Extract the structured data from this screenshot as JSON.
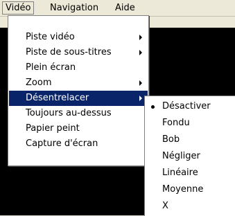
{
  "menubar": {
    "items": [
      "Vidéo",
      "Navigation",
      "Aide"
    ]
  },
  "video_menu": {
    "items": [
      {
        "label": "Piste vidéo",
        "submenu": true
      },
      {
        "label": "Piste de sous-titres",
        "submenu": true
      },
      {
        "label": "Plein écran",
        "submenu": false
      },
      {
        "label": "Zoom",
        "submenu": true
      },
      {
        "label": "Désentrelacer",
        "submenu": true,
        "selected": true
      },
      {
        "label": "Toujours au-dessus",
        "submenu": false
      },
      {
        "label": "Papier peint",
        "submenu": false
      },
      {
        "label": "Capture d'écran",
        "submenu": false
      }
    ]
  },
  "deinterlace_menu": {
    "items": [
      {
        "label": "Désactiver",
        "checked": true
      },
      {
        "label": "Fondu"
      },
      {
        "label": "Bob"
      },
      {
        "label": "Négliger"
      },
      {
        "label": "Linéaire"
      },
      {
        "label": "Moyenne"
      },
      {
        "label": "X"
      }
    ]
  },
  "colors": {
    "menu_highlight": "#0a246a",
    "menubar_bg": "#ece9d8",
    "video_bg": "#000000"
  }
}
